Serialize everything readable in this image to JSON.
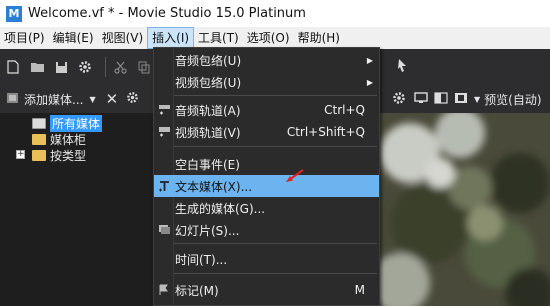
{
  "window": {
    "app_icon": "M",
    "title": "Welcome.vf * - Movie Studio 15.0 Platinum"
  },
  "menubar": {
    "items": [
      "项目(P)",
      "编辑(E)",
      "视图(V)",
      "插入(I)",
      "工具(T)",
      "选项(O)",
      "帮助(H)"
    ],
    "active_index": 3
  },
  "toolbar": {
    "icons": [
      "new-file-icon",
      "open-folder-icon",
      "save-icon",
      "settings-gear-icon",
      "cut-icon",
      "copy-icon",
      "paste-icon",
      "snap-icon"
    ]
  },
  "media_panel": {
    "title": "添加媒体...",
    "tree": [
      {
        "label": "所有媒体",
        "selected": true,
        "expandable": false
      },
      {
        "label": "媒体柜",
        "selected": false,
        "expandable": false
      },
      {
        "label": "按类型",
        "selected": false,
        "expandable": true
      }
    ]
  },
  "preview_panel": {
    "label": "预览(自动)"
  },
  "insert_menu": {
    "items": [
      {
        "label": "音频包络(U)",
        "shortcut": "",
        "submenu": true,
        "icon": ""
      },
      {
        "label": "视频包络(U)",
        "shortcut": "",
        "submenu": true,
        "icon": ""
      },
      {
        "label": "音频轨道(A)",
        "shortcut": "Ctrl+Q",
        "submenu": false,
        "icon": "audio-track-icon"
      },
      {
        "label": "视频轨道(V)",
        "shortcut": "Ctrl+Shift+Q",
        "submenu": false,
        "icon": "video-track-icon"
      },
      {
        "label": "空白事件(E)",
        "shortcut": "",
        "submenu": false,
        "icon": ""
      },
      {
        "label": "文本媒体(X)...",
        "shortcut": "",
        "submenu": false,
        "icon": "text-media-icon",
        "highlighted": true
      },
      {
        "label": "生成的媒体(G)...",
        "shortcut": "",
        "submenu": false,
        "icon": ""
      },
      {
        "label": "幻灯片(S)...",
        "shortcut": "",
        "submenu": false,
        "icon": "slideshow-icon"
      },
      {
        "label": "时间(T)...",
        "shortcut": "",
        "submenu": false,
        "icon": ""
      },
      {
        "label": "标记(M)",
        "shortcut": "M",
        "submenu": false,
        "icon": "marker-icon"
      }
    ]
  },
  "colors": {
    "highlight": "#6bb4f0",
    "selection": "#3399ff",
    "annotation_arrow": "#e02020"
  }
}
